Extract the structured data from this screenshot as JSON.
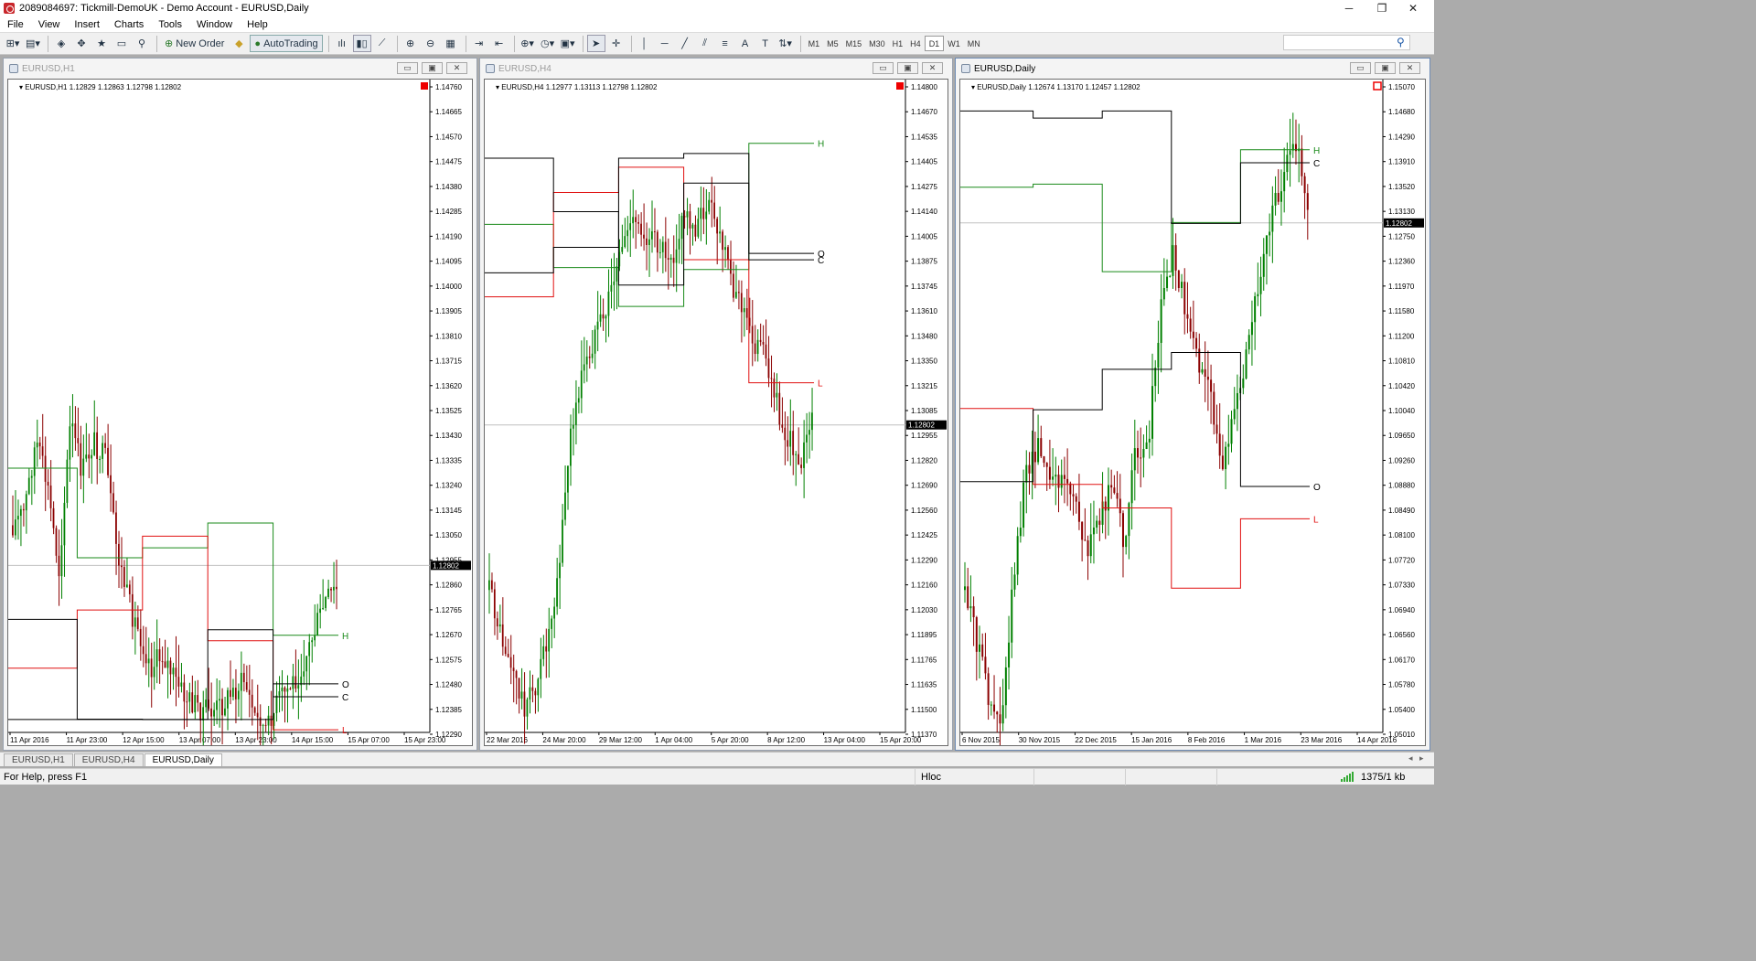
{
  "window": {
    "title": "2089084697: Tickmill-DemoUK - Demo Account - EURUSD,Daily",
    "controls": [
      "─",
      "❐",
      "✕"
    ]
  },
  "menu": [
    "File",
    "View",
    "Insert",
    "Charts",
    "Tools",
    "Window",
    "Help"
  ],
  "toolbar": {
    "new_order": "New Order",
    "autotrading": "AutoTrading",
    "timeframes": [
      "M1",
      "M5",
      "M15",
      "M30",
      "H1",
      "H4",
      "D1",
      "W1",
      "MN"
    ],
    "active_timeframe": "D1",
    "search_placeholder": ""
  },
  "colors": {
    "bull_candle": "#008000",
    "bear_candle": "#8b0000",
    "high_line": "#1a8a1a",
    "low_line": "#e01010",
    "open_close_line": "#000000",
    "price_line": "#c0c0c0"
  },
  "charts": [
    {
      "window_title": "EURUSD,H1",
      "active": false,
      "info": "EURUSD,H1  1.12829 1.12863 1.12798 1.12802",
      "current_price": "1.12802",
      "price_ticks": [
        "1.14760",
        "1.14665",
        "1.14570",
        "1.14475",
        "1.14380",
        "1.14285",
        "1.14190",
        "1.14095",
        "1.14000",
        "1.13905",
        "1.13810",
        "1.13715",
        "1.13620",
        "1.13525",
        "1.13430",
        "1.13335",
        "1.13240",
        "1.13145",
        "1.13050",
        "1.12955",
        "1.12860",
        "1.12765",
        "1.12670",
        "1.12575",
        "1.12480",
        "1.12385",
        "1.12290"
      ],
      "time_ticks": [
        "11 Apr 2016",
        "11 Apr 23:00",
        "12 Apr 15:00",
        "13 Apr 07:00",
        "13 Apr 23:00",
        "14 Apr 15:00",
        "15 Apr 07:00",
        "15 Apr 23:00"
      ],
      "labels": {
        "H": "H",
        "O": "O",
        "C": "C",
        "L": "L"
      }
    },
    {
      "window_title": "EURUSD,H4",
      "active": false,
      "info": "EURUSD,H4  1.12977 1.13113 1.12798 1.12802",
      "current_price": "1.12802",
      "price_ticks": [
        "1.14800",
        "1.14670",
        "1.14535",
        "1.14405",
        "1.14275",
        "1.14140",
        "1.14005",
        "1.13875",
        "1.13745",
        "1.13610",
        "1.13480",
        "1.13350",
        "1.13215",
        "1.13085",
        "1.12955",
        "1.12820",
        "1.12690",
        "1.12560",
        "1.12425",
        "1.12290",
        "1.12160",
        "1.12030",
        "1.11895",
        "1.11765",
        "1.11635",
        "1.11500",
        "1.11370"
      ],
      "time_ticks": [
        "22 Mar 2016",
        "24 Mar 20:00",
        "29 Mar 12:00",
        "1 Apr 04:00",
        "5 Apr 20:00",
        "8 Apr 12:00",
        "13 Apr 04:00",
        "15 Apr 20:00"
      ],
      "labels": {
        "H": "H",
        "O": "O",
        "C": "C",
        "L": "L"
      }
    },
    {
      "window_title": "EURUSD,Daily",
      "active": true,
      "info": "EURUSD,Daily  1.12674 1.13170 1.12457 1.12802",
      "current_price": "1.12802",
      "price_ticks": [
        "1.15070",
        "1.14680",
        "1.14290",
        "1.13910",
        "1.13520",
        "1.13130",
        "1.12750",
        "1.12360",
        "1.11970",
        "1.11580",
        "1.11200",
        "1.10810",
        "1.10420",
        "1.10040",
        "1.09650",
        "1.09260",
        "1.08880",
        "1.08490",
        "1.08100",
        "1.07720",
        "1.07330",
        "1.06940",
        "1.06560",
        "1.06170",
        "1.05780",
        "1.05400",
        "1.05010"
      ],
      "time_ticks": [
        "6 Nov 2015",
        "30 Nov 2015",
        "22 Dec 2015",
        "15 Jan 2016",
        "8 Feb 2016",
        "1 Mar 2016",
        "23 Mar 2016",
        "14 Apr 2016"
      ],
      "labels": {
        "H": "H",
        "O": "O",
        "C": "C",
        "L": "L"
      }
    }
  ],
  "tabs": [
    "EURUSD,H1",
    "EURUSD,H4",
    "EURUSD,Daily"
  ],
  "active_tab": "EURUSD,Daily",
  "status": {
    "help": "For Help, press F1",
    "profile": "Hloc",
    "traffic": "1375/1 kb"
  }
}
